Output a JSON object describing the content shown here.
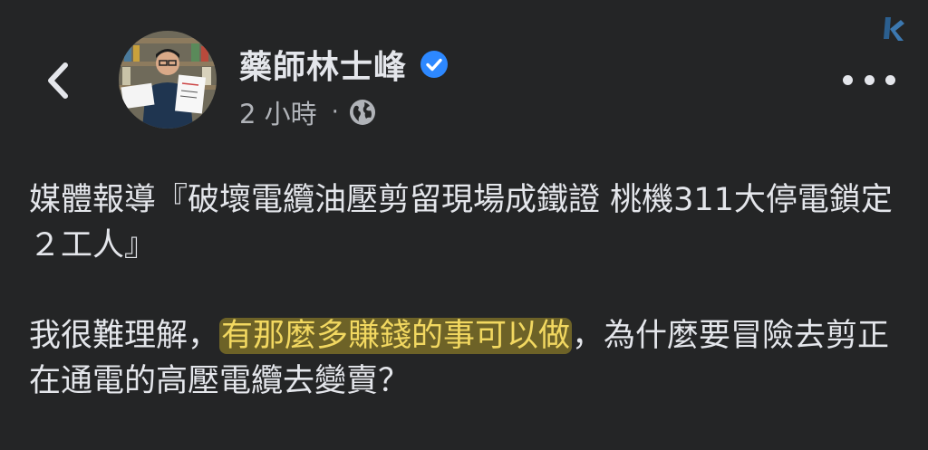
{
  "header": {
    "author_name": "藥師林士峰",
    "time": "2 小時",
    "separator": "·",
    "privacy_icon": "globe-icon",
    "verified_icon": "verified-badge-icon",
    "back_icon": "chevron-left-icon",
    "more_icon": "more-horizontal-icon",
    "verified_color": "#2d88ff"
  },
  "post": {
    "para1": "媒體報導『破壞電纜油壓剪留現場成鐵證 桃機311大停電鎖定２工人』",
    "para2_before": "我很難理解，",
    "para2_highlight": "有那麼多賺錢的事可以做",
    "para2_after": "，為什麼要冒險去剪正在通電的高壓電纜去變賣？",
    "highlight_color": "#f2d860"
  }
}
